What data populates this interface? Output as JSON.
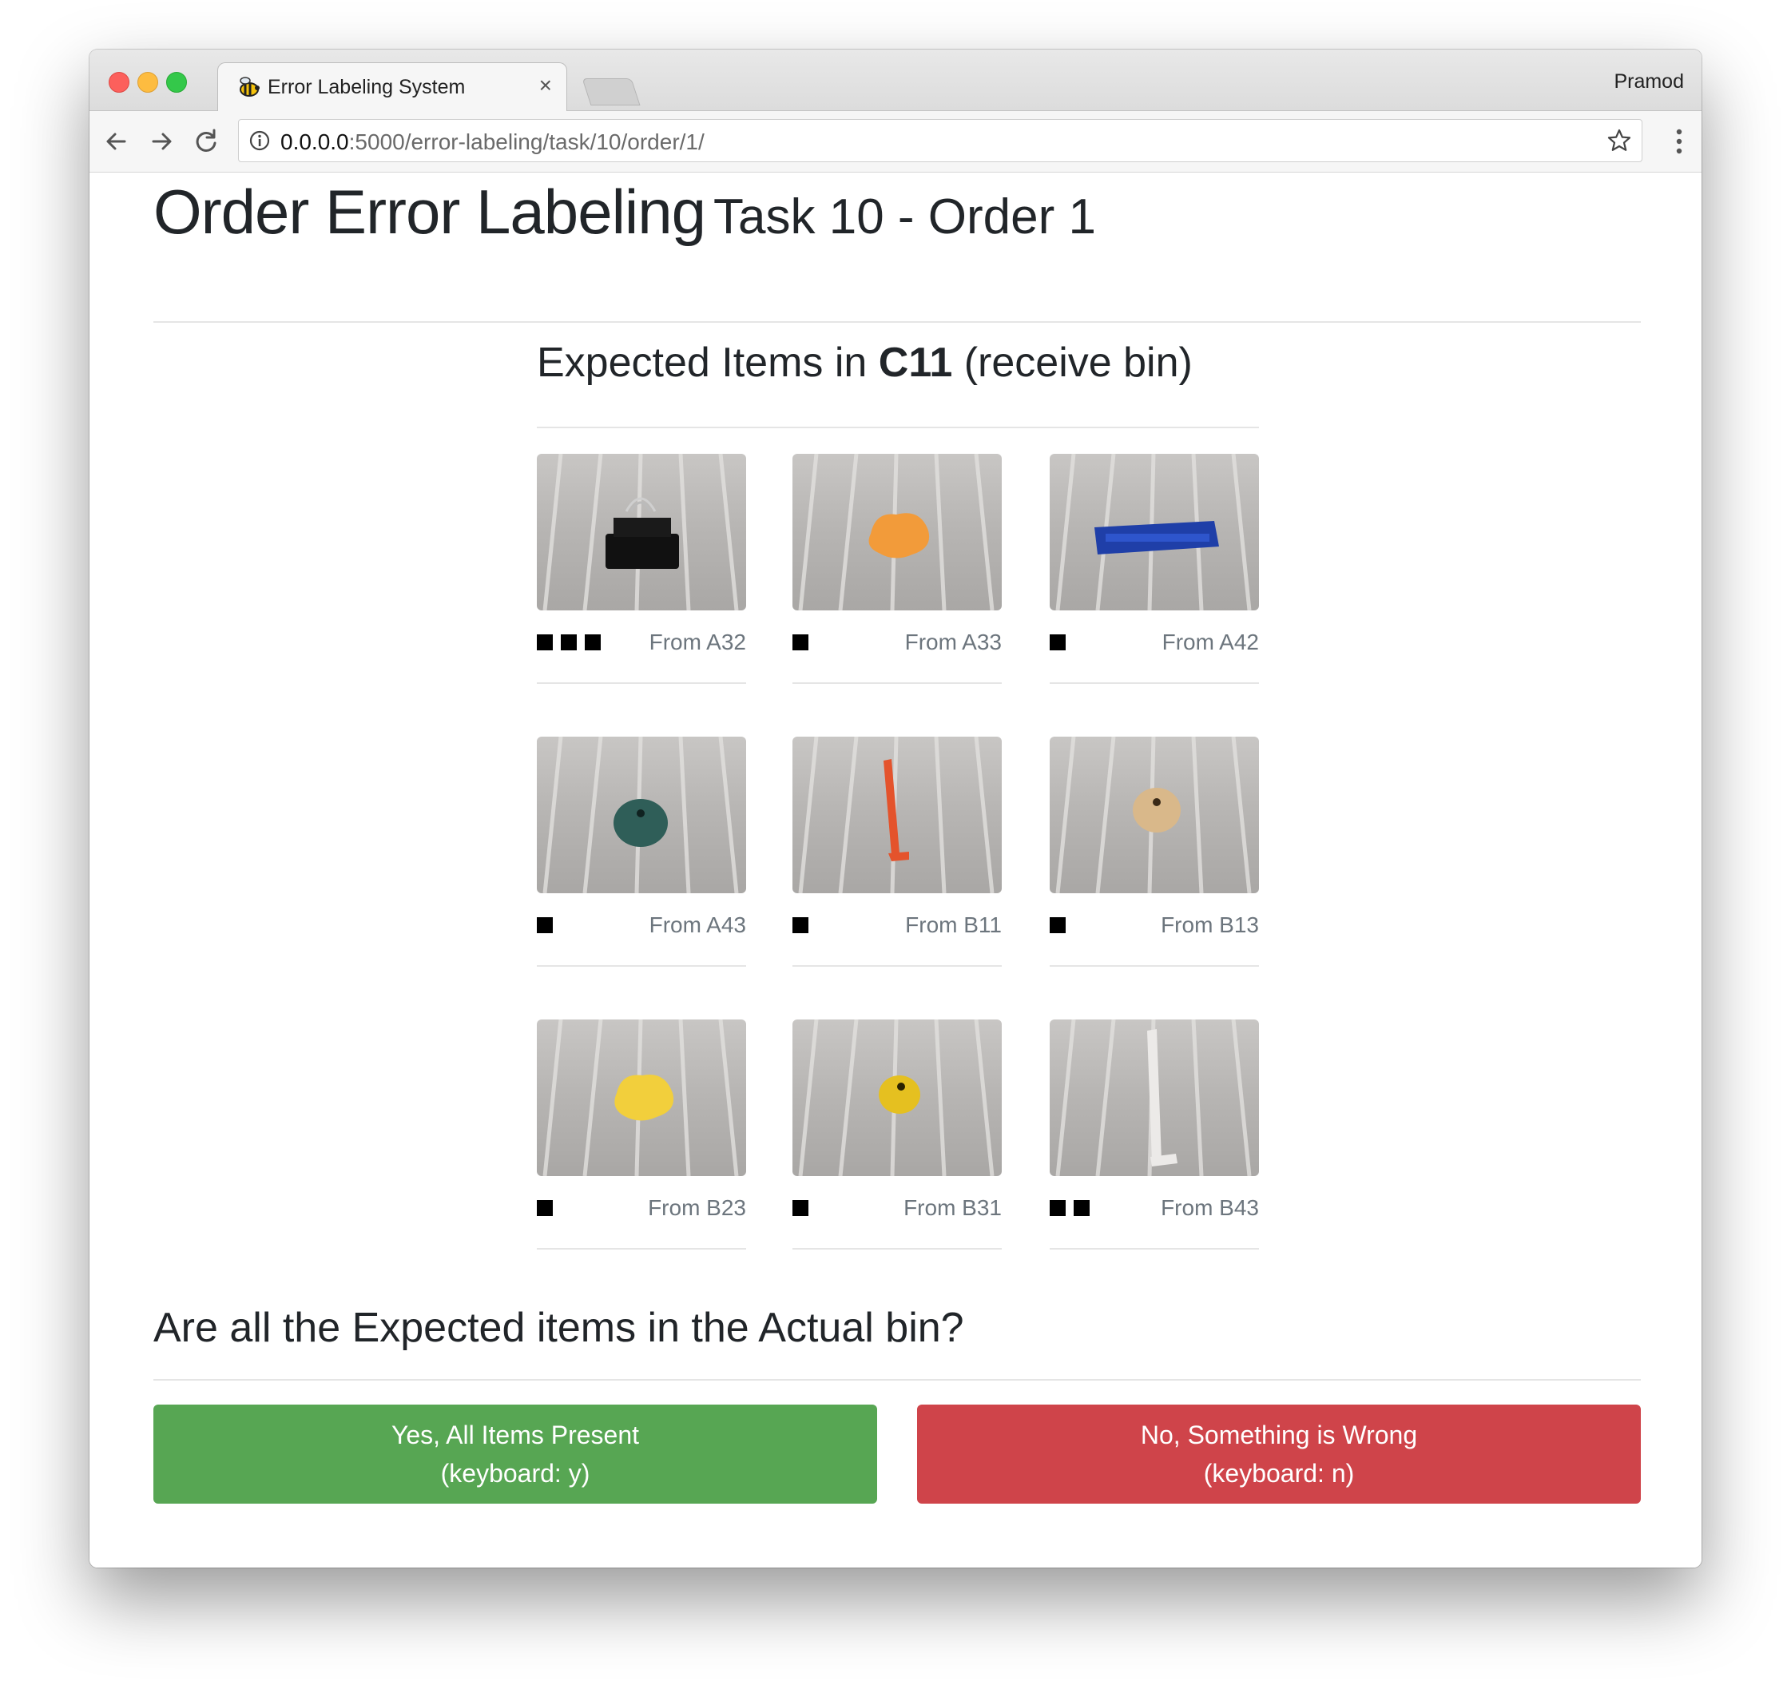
{
  "browser": {
    "tab_title": "Error Labeling System",
    "tab_close": "×",
    "profile_name": "Pramod",
    "url_host": "0.0.0.0",
    "url_path": ":5000/error-labeling/task/10/order/1/"
  },
  "page": {
    "title": "Order Error Labeling",
    "subtitle": "Task 10 - Order 1",
    "expected_prefix": "Expected Items in ",
    "bin_id": "C11",
    "expected_suffix": " (receive bin)",
    "question": "Are all the Expected items in the Actual bin?",
    "yes_label": "Yes, All Items Present",
    "yes_hint": "(keyboard: y)",
    "no_label": "No, Something is Wrong",
    "no_hint": "(keyboard: n)",
    "colors": {
      "yes": "#57a653",
      "no": "#cf444a"
    }
  },
  "items": [
    {
      "from": "From A32",
      "count": 3,
      "object": "black binder clip"
    },
    {
      "from": "From A33",
      "count": 1,
      "object": "orange sponge"
    },
    {
      "from": "From A42",
      "count": 1,
      "object": "blue plastic clip"
    },
    {
      "from": "From A43",
      "count": 1,
      "object": "green ball"
    },
    {
      "from": "From B11",
      "count": 1,
      "object": "red bag clip"
    },
    {
      "from": "From B13",
      "count": 1,
      "object": "wooden ball"
    },
    {
      "from": "From B23",
      "count": 1,
      "object": "yellow sponge"
    },
    {
      "from": "From B31",
      "count": 1,
      "object": "yellow ball"
    },
    {
      "from": "From B43",
      "count": 2,
      "object": "white bag clip"
    }
  ]
}
